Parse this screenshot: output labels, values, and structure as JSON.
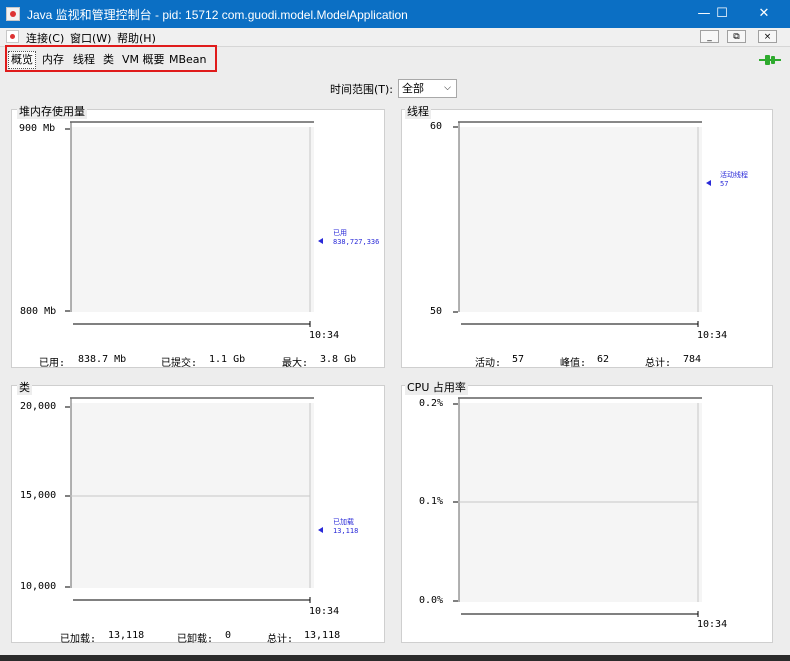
{
  "window": {
    "title": "Java 监视和管理控制台 - pid: 15712 com.guodi.model.ModelApplication",
    "controls": {
      "minimize": "—",
      "maximize": "☐",
      "close": "✕"
    }
  },
  "menubar": {
    "items": [
      "连接(C)",
      "窗口(W)",
      "帮助(H)"
    ],
    "mdi_buttons": [
      "_",
      "⧉",
      "×"
    ]
  },
  "tabs": [
    "概览",
    "内存",
    "线程",
    "类",
    "VM 概要",
    "MBean"
  ],
  "selected_tab": "概览",
  "time_range": {
    "label": "时间范围(T):",
    "value": "全部"
  },
  "colors": {
    "accent": "#0b6fc4",
    "highlight": "#e01b1b",
    "legend": "#2a2ad8",
    "connection": "#2eaa2e"
  },
  "icons": {
    "app": "java-cup-icon",
    "connection": "connected-plug-icon"
  },
  "panels": {
    "heap": {
      "title": "堆内存使用量",
      "y_ticks": [
        "900 Mb",
        "800 Mb"
      ],
      "x_tick": "10:34",
      "legend": {
        "label": "已用",
        "value": "838,727,336"
      },
      "stats": [
        {
          "label": "已用:",
          "value": "838.7 Mb"
        },
        {
          "label": "已提交:",
          "value": "1.1 Gb"
        },
        {
          "label": "最大:",
          "value": "3.8 Gb"
        }
      ]
    },
    "threads": {
      "title": "线程",
      "y_ticks": [
        "60",
        "50"
      ],
      "x_tick": "10:34",
      "legend": {
        "label": "活动线程",
        "value": "57"
      },
      "stats": [
        {
          "label": "活动:",
          "value": "57"
        },
        {
          "label": "峰值:",
          "value": "62"
        },
        {
          "label": "总计:",
          "value": "784"
        }
      ]
    },
    "classes": {
      "title": "类",
      "y_ticks": [
        "20,000",
        "15,000",
        "10,000"
      ],
      "x_tick": "10:34",
      "legend": {
        "label": "已加载",
        "value": "13,118"
      },
      "stats": [
        {
          "label": "已加载:",
          "value": "13,118"
        },
        {
          "label": "已卸载:",
          "value": "0"
        },
        {
          "label": "总计:",
          "value": "13,118"
        }
      ]
    },
    "cpu": {
      "title": "CPU 占用率",
      "y_ticks": [
        "0.2%",
        "0.1%",
        "0.0%"
      ],
      "x_tick": "10:34"
    }
  },
  "chart_data": [
    {
      "type": "line",
      "title": "堆内存使用量",
      "ylim": [
        800,
        900
      ],
      "yunit": "Mb",
      "x": [
        "10:34"
      ],
      "series": [
        {
          "name": "已用",
          "values": [
            838.727336
          ]
        }
      ]
    },
    {
      "type": "line",
      "title": "线程",
      "ylim": [
        50,
        60
      ],
      "x": [
        "10:34"
      ],
      "series": [
        {
          "name": "活动线程",
          "values": [
            57
          ]
        }
      ]
    },
    {
      "type": "line",
      "title": "类",
      "ylim": [
        10000,
        20000
      ],
      "x": [
        "10:34"
      ],
      "series": [
        {
          "name": "已加载",
          "values": [
            13118
          ]
        }
      ]
    },
    {
      "type": "line",
      "title": "CPU 占用率",
      "ylim": [
        0.0,
        0.2
      ],
      "yunit": "%",
      "x": [
        "10:34"
      ],
      "series": []
    }
  ]
}
